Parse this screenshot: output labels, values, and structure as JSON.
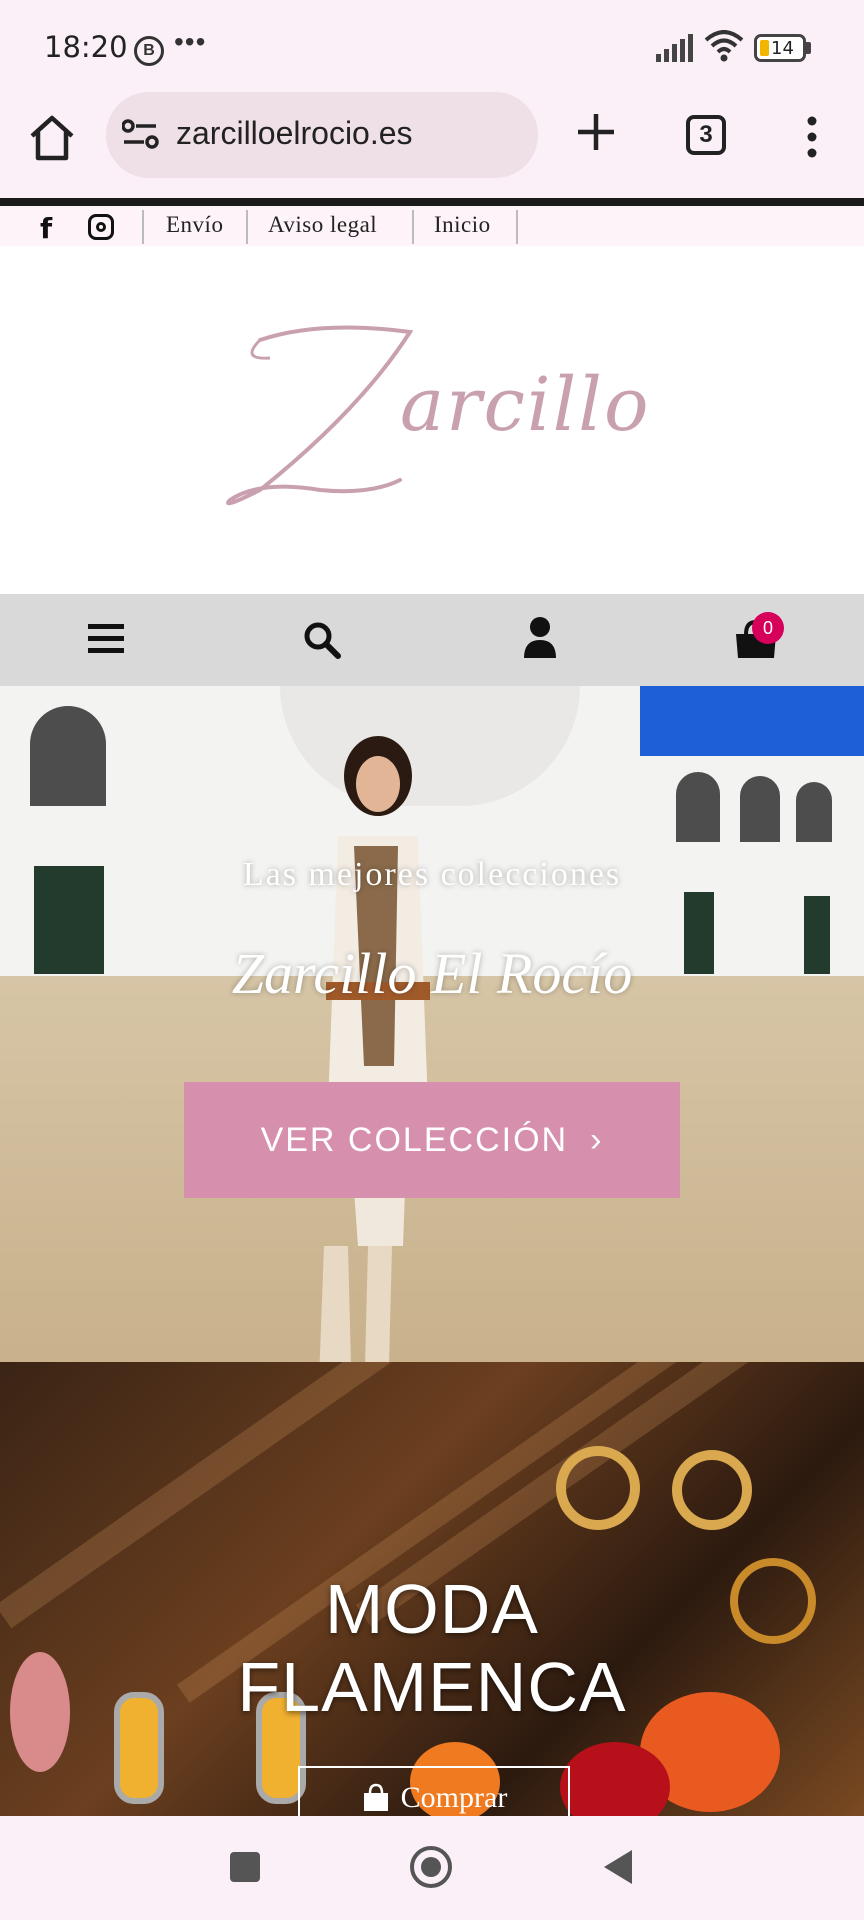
{
  "status_bar": {
    "time": "18:20",
    "notification_icon": "B",
    "more": "•••",
    "battery_level": "14"
  },
  "browser": {
    "url": "zarcilloelrocio.es",
    "tab_count": "3"
  },
  "topbar": {
    "links": [
      "Envío",
      "Aviso legal",
      "Inicio"
    ]
  },
  "logo": {
    "text": "Zarcillo",
    "color": "#c9a0b0"
  },
  "nav": {
    "cart_count": "0",
    "badge_color": "#d6005b"
  },
  "hero": {
    "tagline": "Las mejores colecciones",
    "title": "Zarcillo El Rocío",
    "cta_label": "VER COLECCIÓN",
    "cta_arrow": "›",
    "cta_color": "#d78fae"
  },
  "flamenca": {
    "title_line1": "MODA",
    "title_line2": "FLAMENCA",
    "button_label": "Comprar"
  }
}
